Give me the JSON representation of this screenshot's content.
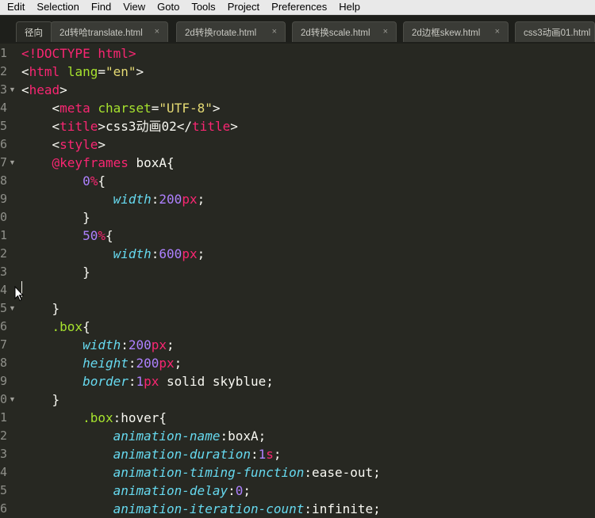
{
  "menu": [
    "Edit",
    "Selection",
    "Find",
    "View",
    "Goto",
    "Tools",
    "Project",
    "Preferences",
    "Help"
  ],
  "tabs": [
    {
      "label": "径向"
    },
    {
      "label": "2d转哈translate.html",
      "close": "×"
    },
    {
      "label": "2d转换rotate.html",
      "close": "×"
    },
    {
      "label": "2d转换scale.html",
      "close": "×"
    },
    {
      "label": "2d边框skew.html",
      "close": "×"
    },
    {
      "label": "css3动画01.html",
      "close": ""
    }
  ],
  "line_numbers": [
    "1",
    "2",
    "3",
    "4",
    "5",
    "6",
    "7",
    "8",
    "9",
    "0",
    "1",
    "2",
    "3",
    "4",
    "5",
    "6",
    "7",
    "8",
    "9",
    "0",
    "1",
    "2",
    "3",
    "4",
    "5",
    "6"
  ],
  "code": [
    [
      [
        "tag",
        "<!DOCTYPE html>"
      ]
    ],
    [
      [
        "plain",
        "<"
      ],
      [
        "tag",
        "html"
      ],
      [
        "plain",
        " "
      ],
      [
        "attr",
        "lang"
      ],
      [
        "plain",
        "="
      ],
      [
        "str",
        "\"en\""
      ],
      [
        "plain",
        ">"
      ]
    ],
    [
      [
        "plain",
        "<"
      ],
      [
        "tag",
        "head"
      ],
      [
        "plain",
        ">"
      ]
    ],
    [
      [
        "plain",
        "    <"
      ],
      [
        "tag",
        "meta"
      ],
      [
        "plain",
        " "
      ],
      [
        "attr",
        "charset"
      ],
      [
        "plain",
        "="
      ],
      [
        "str",
        "\"UTF-8\""
      ],
      [
        "plain",
        ">"
      ]
    ],
    [
      [
        "plain",
        "    <"
      ],
      [
        "tag",
        "title"
      ],
      [
        "plain",
        ">css3动画02</"
      ],
      [
        "tag",
        "title"
      ],
      [
        "plain",
        ">"
      ]
    ],
    [
      [
        "plain",
        "    <"
      ],
      [
        "tag",
        "style"
      ],
      [
        "plain",
        ">"
      ]
    ],
    [
      [
        "plain",
        "    "
      ],
      [
        "at",
        "@keyframes"
      ],
      [
        "plain",
        " boxA{"
      ]
    ],
    [
      [
        "plain",
        "        "
      ],
      [
        "num",
        "0"
      ],
      [
        "unit",
        "%"
      ],
      [
        "plain",
        "{"
      ]
    ],
    [
      [
        "plain",
        "            "
      ],
      [
        "prop",
        "width"
      ],
      [
        "plain",
        ":"
      ],
      [
        "num",
        "200"
      ],
      [
        "unit",
        "px"
      ],
      [
        "plain",
        ";"
      ]
    ],
    [
      [
        "plain",
        "        }"
      ]
    ],
    [
      [
        "plain",
        "        "
      ],
      [
        "num",
        "50"
      ],
      [
        "unit",
        "%"
      ],
      [
        "plain",
        "{"
      ]
    ],
    [
      [
        "plain",
        "            "
      ],
      [
        "prop",
        "width"
      ],
      [
        "plain",
        ":"
      ],
      [
        "num",
        "600"
      ],
      [
        "unit",
        "px"
      ],
      [
        "plain",
        ";"
      ]
    ],
    [
      [
        "plain",
        "        }"
      ]
    ],
    [
      [
        "plain",
        ""
      ]
    ],
    [
      [
        "plain",
        "    }"
      ]
    ],
    [
      [
        "plain",
        "    "
      ],
      [
        "sel",
        ".box"
      ],
      [
        "plain",
        "{"
      ]
    ],
    [
      [
        "plain",
        "        "
      ],
      [
        "prop",
        "width"
      ],
      [
        "plain",
        ":"
      ],
      [
        "num",
        "200"
      ],
      [
        "unit",
        "px"
      ],
      [
        "plain",
        ";"
      ]
    ],
    [
      [
        "plain",
        "        "
      ],
      [
        "prop",
        "height"
      ],
      [
        "plain",
        ":"
      ],
      [
        "num",
        "200"
      ],
      [
        "unit",
        "px"
      ],
      [
        "plain",
        ";"
      ]
    ],
    [
      [
        "plain",
        "        "
      ],
      [
        "prop",
        "border"
      ],
      [
        "plain",
        ":"
      ],
      [
        "num",
        "1"
      ],
      [
        "unit",
        "px"
      ],
      [
        "plain",
        " solid skyblue;"
      ]
    ],
    [
      [
        "plain",
        "    }"
      ]
    ],
    [
      [
        "plain",
        "        "
      ],
      [
        "sel",
        ".box"
      ],
      [
        "plain",
        ":hover{"
      ]
    ],
    [
      [
        "plain",
        "            "
      ],
      [
        "prop",
        "animation-name"
      ],
      [
        "plain",
        ":boxA;"
      ]
    ],
    [
      [
        "plain",
        "            "
      ],
      [
        "prop",
        "animation-duration"
      ],
      [
        "plain",
        ":"
      ],
      [
        "num",
        "1"
      ],
      [
        "unit",
        "s"
      ],
      [
        "plain",
        ";"
      ]
    ],
    [
      [
        "plain",
        "            "
      ],
      [
        "prop",
        "animation-timing-function"
      ],
      [
        "plain",
        ":ease-out;"
      ]
    ],
    [
      [
        "plain",
        "            "
      ],
      [
        "prop",
        "animation-delay"
      ],
      [
        "plain",
        ":"
      ],
      [
        "num",
        "0"
      ],
      [
        "plain",
        ";"
      ]
    ],
    [
      [
        "plain",
        "            "
      ],
      [
        "prop",
        "animation-iteration-count"
      ],
      [
        "plain",
        ":infinite;"
      ]
    ]
  ],
  "fold_rows": [
    2,
    6,
    14,
    19
  ],
  "fold_glyph": "▼"
}
